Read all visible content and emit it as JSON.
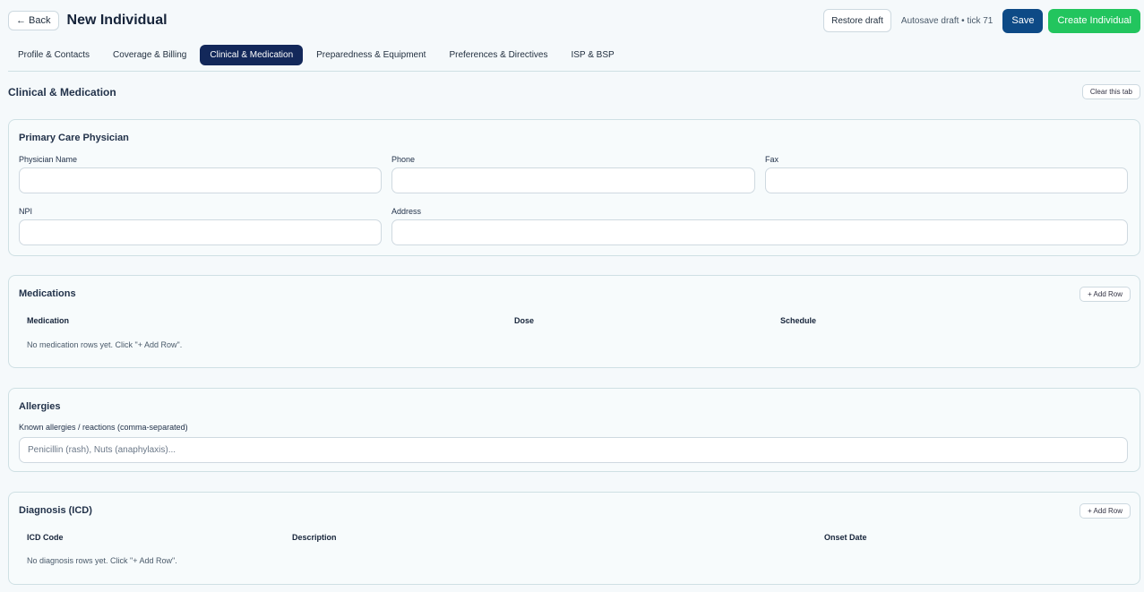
{
  "header": {
    "back_label": "← Back",
    "title": "New Individual",
    "restore_label": "Restore draft",
    "autosave_text": "Autosave draft • tick 71",
    "save_label": "Save",
    "create_label": "Create Individual"
  },
  "tabs": [
    {
      "label": "Profile & Contacts"
    },
    {
      "label": "Coverage & Billing"
    },
    {
      "label": "Clinical & Medication"
    },
    {
      "label": "Preparedness & Equipment"
    },
    {
      "label": "Preferences & Directives"
    },
    {
      "label": "ISP & BSP"
    }
  ],
  "section": {
    "title": "Clinical & Medication",
    "clear_label": "Clear this tab"
  },
  "pcp": {
    "title": "Primary Care Physician",
    "physician_name_label": "Physician Name",
    "physician_name_value": "",
    "phone_label": "Phone",
    "phone_value": "",
    "fax_label": "Fax",
    "fax_value": "",
    "npi_label": "NPI",
    "npi_value": "",
    "address_label": "Address",
    "address_value": ""
  },
  "medications": {
    "title": "Medications",
    "add_label": "+ Add Row",
    "columns": [
      "Medication",
      "Dose",
      "Schedule"
    ],
    "empty_text": "No medication rows yet. Click \"+ Add Row\"."
  },
  "allergies": {
    "title": "Allergies",
    "field_label": "Known allergies / reactions (comma-separated)",
    "placeholder": "Penicillin (rash), Nuts (anaphylaxis)...",
    "value": ""
  },
  "diagnosis": {
    "title": "Diagnosis (ICD)",
    "add_label": "+ Add Row",
    "columns": [
      "ICD Code",
      "Description",
      "Onset Date"
    ],
    "empty_text": "No diagnosis rows yet. Click \"+ Add Row\"."
  }
}
